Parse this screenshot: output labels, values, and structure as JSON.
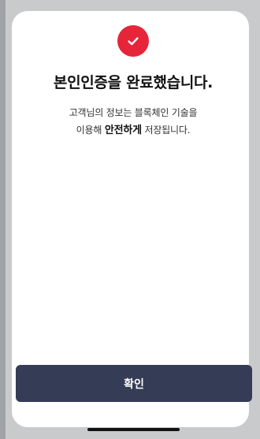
{
  "screen": {
    "icon": "check-circle-icon",
    "accent_color": "#e6253a",
    "button_color": "#353c56",
    "title": "본인인증을 완료했습니다.",
    "description_line1": "고객님의 정보는 블록체인 기술을",
    "description_line2_prefix": "이용해",
    "description_line2_bold": "안전하게",
    "description_line2_suffix": "저장됩니다."
  },
  "actions": {
    "confirm_label": "확인"
  }
}
